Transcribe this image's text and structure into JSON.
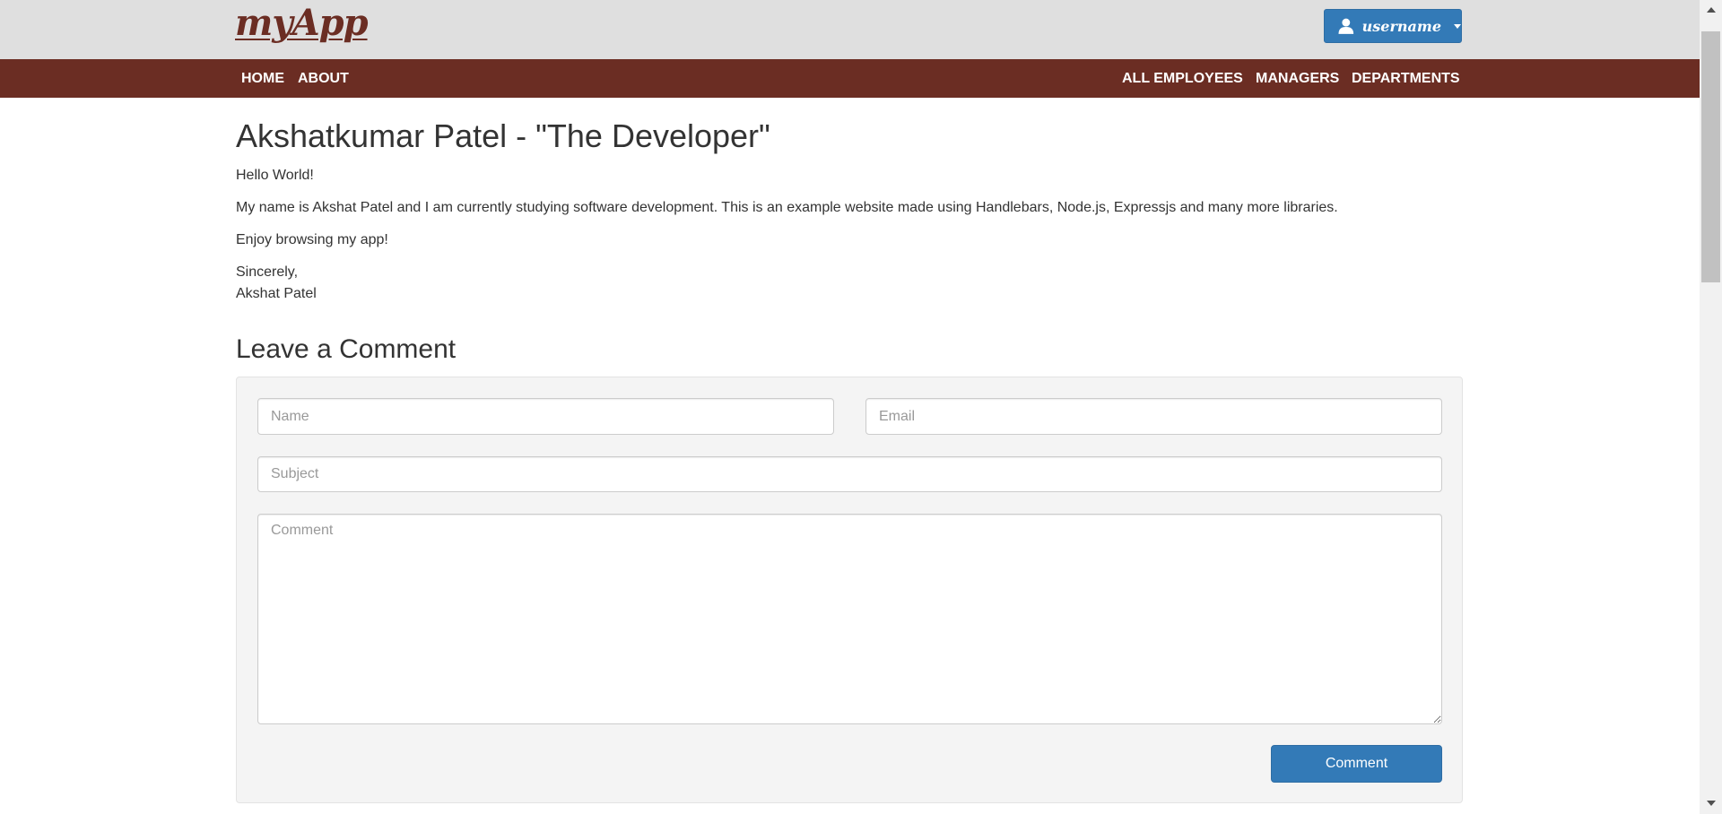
{
  "header": {
    "logo": "myApp",
    "user_menu": {
      "label": "username",
      "icon": "user-icon"
    }
  },
  "nav": {
    "left": [
      {
        "label": "HOME"
      },
      {
        "label": "ABOUT"
      }
    ],
    "right": [
      {
        "label": "ALL EMPLOYEES"
      },
      {
        "label": "MANAGERS"
      },
      {
        "label": "DEPARTMENTS"
      }
    ]
  },
  "main": {
    "title": "Akshatkumar Patel - \"The Developer\"",
    "paragraphs": [
      "Hello World!",
      "My name is Akshat Patel and I am currently studying software development. This is an example website made using Handlebars, Node.js, Expressjs and many more libraries.",
      "Enjoy browsing my app!"
    ],
    "signoff": {
      "line1": "Sincerely,",
      "line2": "Akshat Patel"
    }
  },
  "comment_form": {
    "title": "Leave a Comment",
    "name_placeholder": "Name",
    "email_placeholder": "Email",
    "subject_placeholder": "Subject",
    "comment_placeholder": "Comment",
    "submit_label": "Comment"
  },
  "colors": {
    "brand": "#6b2d23",
    "topbar_bg": "#dfdfdf",
    "primary_button": "#337ab7"
  }
}
